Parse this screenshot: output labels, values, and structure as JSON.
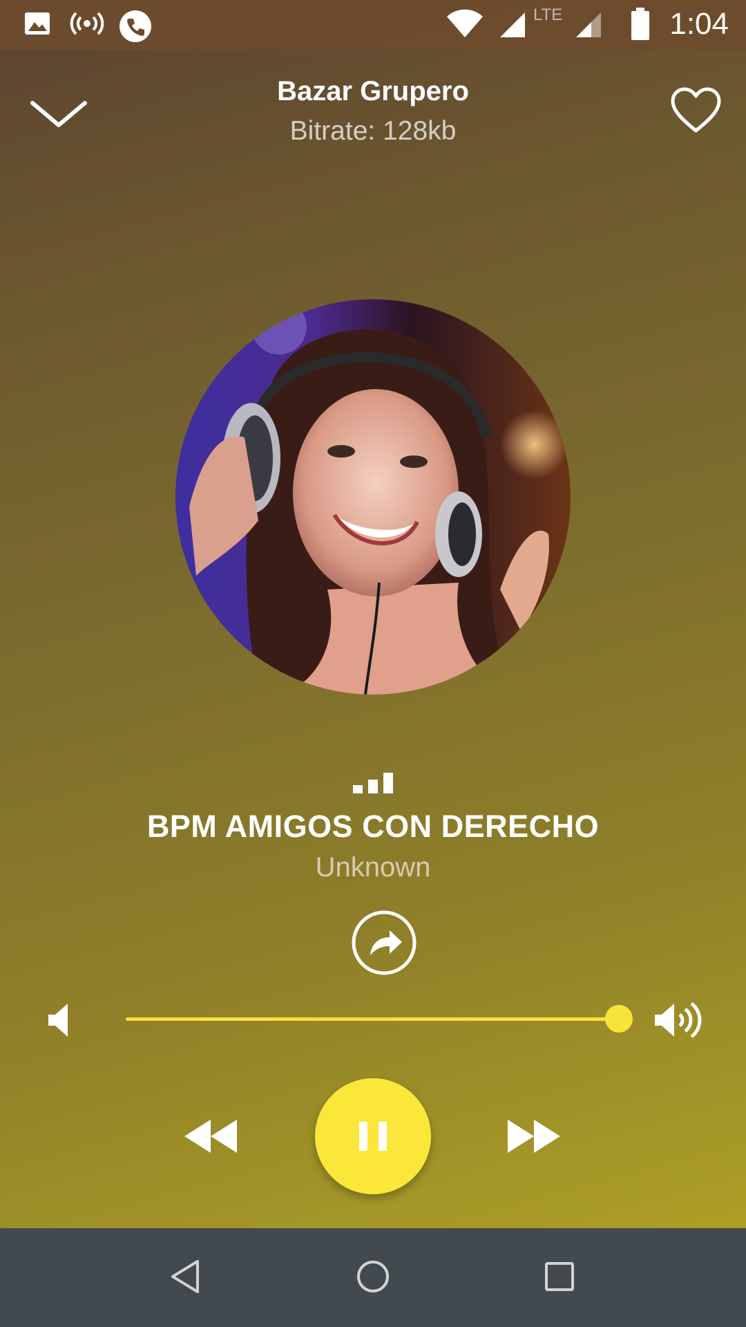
{
  "status_bar": {
    "time": "1:04",
    "network_label": "LTE",
    "icons": [
      "image-icon",
      "hotspot-icon",
      "phone-call-icon",
      "wifi-icon",
      "cell-signal-icon",
      "lte-signal-icon",
      "battery-icon"
    ]
  },
  "header": {
    "station_name": "Bazar Grupero",
    "bitrate": "Bitrate: 128kb",
    "icons": [
      "chevron-down-icon",
      "heart-icon"
    ]
  },
  "artwork": {
    "description_icon": "album-art"
  },
  "now_playing": {
    "title": "BPM AMIGOS CON DERECHO",
    "artist": "Unknown",
    "icons": [
      "equalizer-icon",
      "share-icon"
    ]
  },
  "volume": {
    "level": 1.0,
    "icons": [
      "volume-min-icon",
      "volume-max-icon"
    ]
  },
  "controls": {
    "state": "playing",
    "icons": [
      "rewind-icon",
      "pause-icon",
      "fast-forward-icon"
    ]
  },
  "navigation": {
    "icons": [
      "back-icon",
      "home-icon",
      "recents-icon"
    ]
  },
  "colors": {
    "accent": "#fbe73a",
    "nav_bar": "#434a4f",
    "status_bar": "#6e4b2d"
  }
}
